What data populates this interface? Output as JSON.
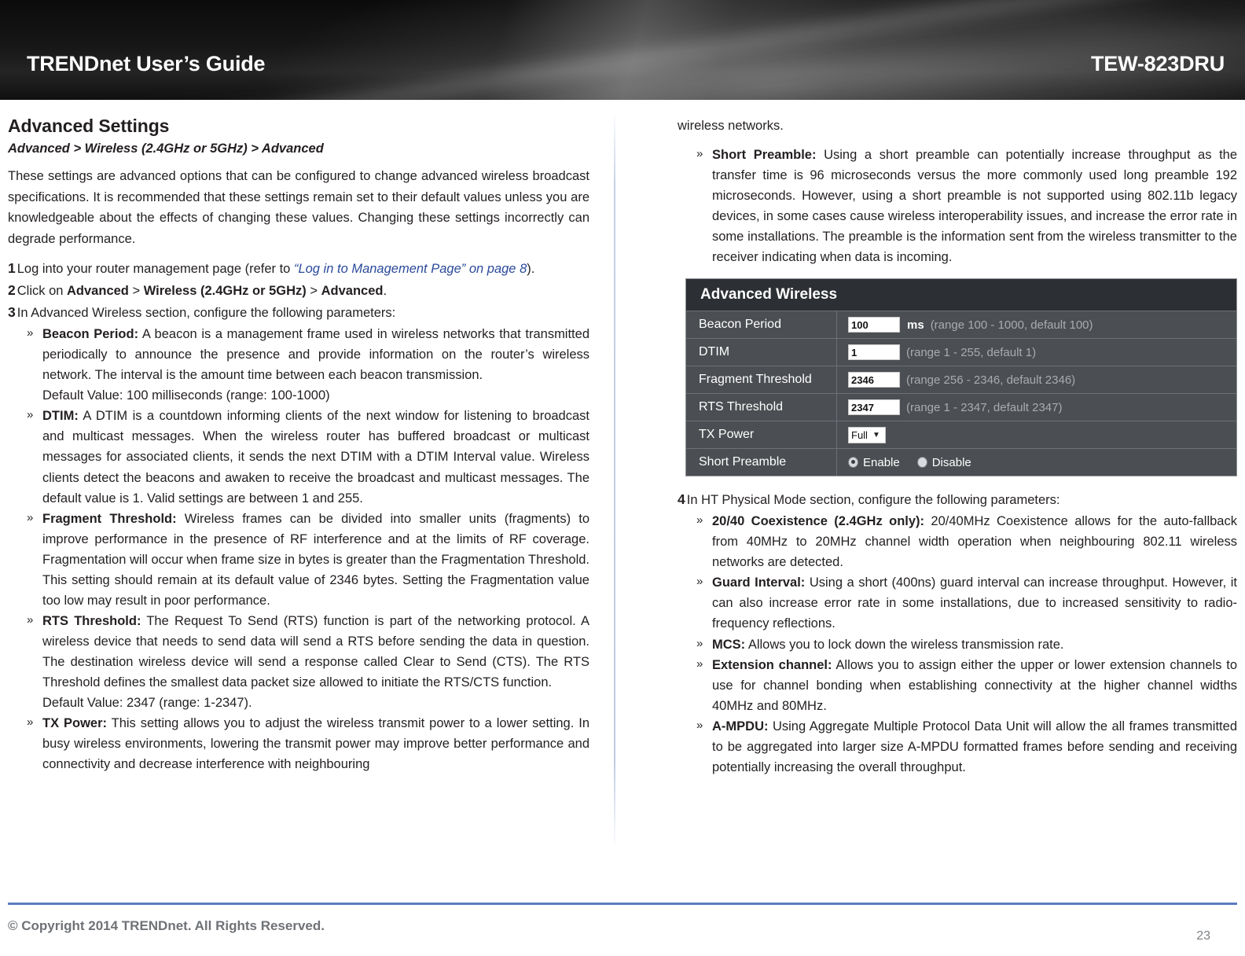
{
  "header": {
    "left_title": "TRENDnet User’s Guide",
    "right_title": "TEW-823DRU"
  },
  "left_column": {
    "section_title": "Advanced Settings",
    "breadcrumb": "Advanced > Wireless (2.4GHz or 5GHz) > Advanced",
    "intro_paragraph": "These settings are advanced options that can be configured to change advanced wireless broadcast specifications. It is recommended that these settings remain set to their default values unless you are knowledgeable about the effects of changing these values. Changing these settings incorrectly can degrade performance.",
    "steps": [
      {
        "number": "1",
        "pre_text": "Log into your router management page (refer to ",
        "link_text": "“Log in to Management Page” on page 8",
        "post_text": ")."
      },
      {
        "number": "2",
        "pre_text": "Click on ",
        "bold_a": "Advanced",
        "sep_a": " > ",
        "bold_b": "Wireless (2.4GHz or 5GHz)",
        "sep_b": " > ",
        "bold_c": "Advanced",
        "post_text": "."
      },
      {
        "number": "3",
        "pre_text": "In Advanced Wireless section, configure the following parameters:"
      }
    ],
    "bullets": [
      {
        "marker": "»",
        "term": "Beacon Period:",
        "body": " A beacon is a management frame used in wireless networks that transmitted periodically to announce the presence and provide information on the router’s wireless network. The interval is the amount time between each beacon transmission.",
        "note": "Default Value: 100 milliseconds (range: 100-1000)"
      },
      {
        "marker": "»",
        "term": "DTIM:",
        "body": " A DTIM is a countdown informing clients of the next window for listening to broadcast and multicast messages. When the wireless router has buffered broadcast or multicast messages for associated clients, it sends the next DTIM with a DTIM Interval value. Wireless clients detect the beacons and awaken to receive the broadcast and multicast messages. The default value is 1. Valid settings are between 1 and 255.",
        "note": ""
      },
      {
        "marker": "»",
        "term": "Fragment Threshold:",
        "body": " Wireless frames can be divided into smaller units (fragments) to improve performance in the presence of RF interference and at the limits of RF coverage. Fragmentation will occur when frame size in bytes is greater than the Fragmentation Threshold. This setting should remain at its default value of 2346 bytes. Setting the Fragmentation value too low may result in poor performance.",
        "note": ""
      },
      {
        "marker": "»",
        "term": "RTS Threshold:",
        "body": " The Request To Send (RTS) function is part of the networking protocol. A wireless device that needs to send data will send a RTS before sending the data in question. The destination wireless device will send a response called Clear to Send (CTS). The RTS Threshold defines the smallest data packet size allowed to initiate the RTS/CTS function.",
        "note": "Default Value: 2347 (range: 1-2347)."
      },
      {
        "marker": "»",
        "term": "TX Power:",
        "body": " This setting allows you to adjust the wireless transmit power to a lower setting. In busy wireless environments, lowering the transmit power may improve better performance and connectivity and decrease interference with neighbouring",
        "note": ""
      }
    ]
  },
  "right_column": {
    "continued_text": "wireless networks.",
    "preamble_bullet": {
      "marker": "»",
      "term": "Short Preamble:",
      "body": " Using a short preamble can potentially increase throughput as the transfer time is 96 microseconds versus the more commonly used long preamble 192 microseconds. However, using a short preamble is not supported using 802.11b legacy devices, in some cases cause wireless interoperability issues, and increase the error rate in some installations. The preamble is the information sent from the wireless transmitter to the receiver indicating when data is incoming."
    },
    "ui_screenshot": {
      "panel_title": "Advanced Wireless",
      "rows": [
        {
          "label": "Beacon Period",
          "type": "text",
          "value": "100",
          "unit": "ms",
          "hint": "(range 100 - 1000, default 100)"
        },
        {
          "label": "DTIM",
          "type": "text",
          "value": "1",
          "unit": "",
          "hint": "(range 1 - 255, default 1)"
        },
        {
          "label": "Fragment Threshold",
          "type": "text",
          "value": "2346",
          "unit": "",
          "hint": "(range 256 - 2346, default 2346)"
        },
        {
          "label": "RTS Threshold",
          "type": "text",
          "value": "2347",
          "unit": "",
          "hint": "(range 1 - 2347, default 2347)"
        },
        {
          "label": "TX Power",
          "type": "select",
          "value": "Full",
          "unit": "",
          "hint": ""
        },
        {
          "label": "Short Preamble",
          "type": "radio",
          "option_a": "Enable",
          "option_b": "Disable",
          "selected": "Enable"
        }
      ]
    },
    "step4": {
      "number": "4",
      "text": "In HT Physical Mode section, configure the following parameters:"
    },
    "bullets": [
      {
        "marker": "»",
        "term": "20/40 Coexistence (2.4GHz only):",
        "body": " 20/40MHz Coexistence allows for the auto-fallback from 40MHz to 20MHz channel width operation when neighbouring 802.11 wireless networks are detected."
      },
      {
        "marker": "»",
        "term": "Guard Interval:",
        "body": " Using a short (400ns) guard interval can increase throughput. However, it can also increase error rate in some installations, due to increased sensitivity to radio-frequency reflections."
      },
      {
        "marker": "»",
        "term": "MCS:",
        "body": " Allows you to lock down the wireless transmission rate."
      },
      {
        "marker": "»",
        "term": "Extension channel:",
        "body": " Allows you to assign either the upper or lower extension channels to use for channel bonding when establishing connectivity at the higher channel widths 40MHz and 80MHz."
      },
      {
        "marker": "»",
        "term": "A-MPDU:",
        "body": " Using Aggregate Multiple Protocol Data Unit will allow the all frames transmitted to be aggregated into larger size A-MPDU formatted frames before sending and receiving potentially increasing the overall throughput."
      }
    ]
  },
  "footer": {
    "copyright": "© Copyright 2014 TRENDnet. All Rights Reserved.",
    "page_number": "23",
    "rule_color": "#5b7cc0"
  }
}
